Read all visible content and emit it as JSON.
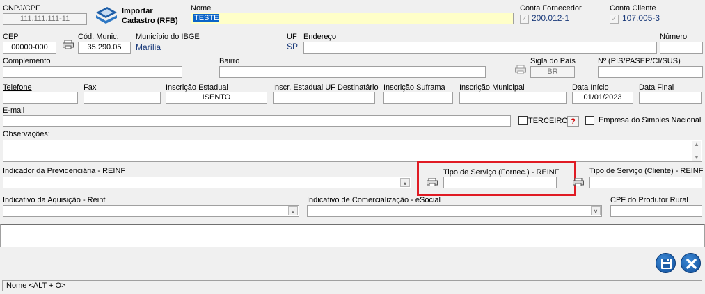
{
  "header": {
    "cnpj_label": "CNPJ/CPF",
    "cnpj_value": "111.111.111-11",
    "import_line1": "Importar",
    "import_line2": "Cadastro (RFB)",
    "nome_label": "Nome",
    "nome_value": "TESTE",
    "conta_fornecedor_label": "Conta Fornecedor",
    "conta_fornecedor_value": "200.012-1",
    "conta_cliente_label": "Conta Cliente",
    "conta_cliente_value": "107.005-3",
    "check_mark": "✓"
  },
  "address": {
    "cep_label": "CEP",
    "cep_value": "00000-000",
    "cod_munic_label": "Cód. Munic.",
    "cod_munic_value": "35.290.05",
    "municipio_label": "Município do IBGE",
    "municipio_value": "Marília",
    "uf_label": "UF",
    "uf_value": "SP",
    "endereco_label": "Endereço",
    "numero_label": "Número",
    "complemento_label": "Complemento",
    "bairro_label": "Bairro",
    "sigla_pais_label": "Sigla do País",
    "sigla_pais_value": "BR",
    "pis_label": "Nº (PIS/PASEP/CI/SUS)"
  },
  "contact": {
    "telefone_label": "Telefone",
    "fax_label": "Fax",
    "ie_label": "Inscrição Estadual",
    "ie_value": "ISENTO",
    "ie_uf_dest_label": "Inscr. Estadual UF Destinatário",
    "suframa_label": "Inscrição Suframa",
    "im_label": "Inscrição Municipal",
    "data_inicio_label": "Data Início",
    "data_inicio_value": "01/01/2023",
    "data_final_label": "Data Final",
    "email_label": "E-mail",
    "terceiro_label": "TERCEIRO",
    "help_label": "?",
    "simples_label": "Empresa do Simples Nacional",
    "obs_label": "Observações:"
  },
  "reinf": {
    "previdenciaria_label": "Indicador da Previdenciária - REINF",
    "tipo_fornec_label": "Tipo de Serviço (Fornec.) - REINF",
    "tipo_cliente_label": "Tipo de Serviço (Cliente) - REINF",
    "aquisicao_label": "Indicativo da Aquisição - Reinf",
    "comercializacao_label": "Indicativo de Comercialização - eSocial",
    "cpf_produtor_label": "CPF do Produtor Rural"
  },
  "status": {
    "text": "Nome <ALT + O>"
  },
  "colors": {
    "highlight": "#e01b24",
    "nome_bg": "#ffffc8",
    "selection": "#0a64c8"
  }
}
